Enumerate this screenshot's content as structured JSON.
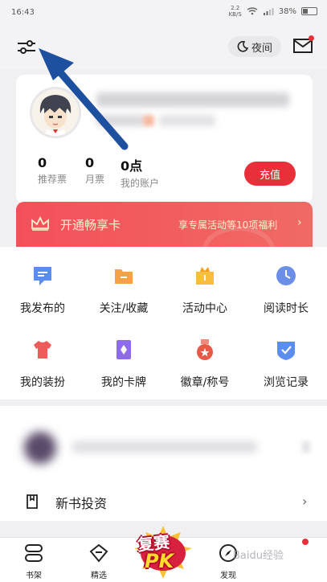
{
  "status_bar": {
    "time": "16:43",
    "net_speed_value": "2.2",
    "net_speed_unit": "KB/S",
    "battery": "38%"
  },
  "header": {
    "night_mode_label": "夜间"
  },
  "profile": {
    "stats": [
      {
        "value": "0",
        "label": "推荐票"
      },
      {
        "value": "0",
        "label": "月票"
      },
      {
        "value": "0点",
        "label": "我的账户"
      }
    ],
    "recharge_label": "充值"
  },
  "vip_banner": {
    "title": "开通畅享卡",
    "desc": "享专属活动等10项福利"
  },
  "grid": [
    {
      "label": "我发布的",
      "icon": "post-icon",
      "color": "#5b8def"
    },
    {
      "label": "关注/收藏",
      "icon": "folder-icon",
      "color": "#f4a245"
    },
    {
      "label": "活动中心",
      "icon": "gift-icon",
      "color": "#f6be3c"
    },
    {
      "label": "阅读时长",
      "icon": "clock-icon",
      "color": "#6b8fe8"
    },
    {
      "label": "我的装扮",
      "icon": "shirt-icon",
      "color": "#ef5a5a"
    },
    {
      "label": "我的卡牌",
      "icon": "card-icon",
      "color": "#8e6be8"
    },
    {
      "label": "徽章/称号",
      "icon": "medal-icon",
      "color": "#e85a48"
    },
    {
      "label": "浏览记录",
      "icon": "shield-icon",
      "color": "#5b8def"
    }
  ],
  "invest": {
    "label": "新书投资"
  },
  "tabbar": {
    "tabs": [
      {
        "label": "书架",
        "icon": "bookshelf-icon"
      },
      {
        "label": "精选",
        "icon": "diamond-icon"
      },
      {
        "label": "发现",
        "icon": "compass-icon"
      }
    ],
    "pk_line1": "复赛",
    "pk_line2": "PK"
  },
  "watermark": "Baidu经验",
  "colors": {
    "accent": "#e8303a",
    "arrow": "#1e50a0"
  }
}
